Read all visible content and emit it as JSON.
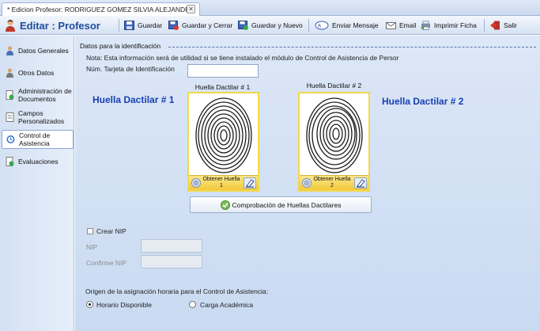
{
  "tab": {
    "title": "* Edicion Profesor: RODRIGUEZ GOMEZ SILVIA ALEJANDRA",
    "close": "✕"
  },
  "toolbar": {
    "title": "Editar : Profesor",
    "save": "Guardar",
    "save_close": "Guardar y Cerrar",
    "save_new": "Guardar y Nuevo",
    "send_message": "Enviar Mensaje",
    "email": "Email",
    "print": "Imprimir Ficha",
    "exit": "Salir"
  },
  "sidebar": {
    "items": [
      {
        "label": "Datos Generales"
      },
      {
        "label": "Otros Datos"
      },
      {
        "label": "Administración de Documentos"
      },
      {
        "label": "Campos Personalizados"
      },
      {
        "label": "Control de Asistencia"
      },
      {
        "label": "Evaluaciones"
      }
    ]
  },
  "form": {
    "group_title": "Datos para la identificación",
    "note": "Nota: Esta información será de utilidad si se tiene instalado el módulo de Control de Asistencia de Persor",
    "card_label": "Núm. Tarjeta de Identificación",
    "card_value": "",
    "fp1_big": "Huella Dactilar # 1",
    "fp2_big": "Huella Dactilar # 2",
    "fp1_caption": "Huella Dactilar # 1",
    "fp2_caption": "Huella Dactilar # 2",
    "fp1_get": "Obtener Huella 1",
    "fp2_get": "Obtener Huella 2",
    "check_button": "Comprobación de Huellas Dactilares",
    "create_nip": "Crear NIP",
    "nip_label": "NIP",
    "confirm_nip_label": "Confirme NIP",
    "schedule_label": "Origen de la asignación horaria para el Control de Asistencia:",
    "option_available": "Horario Disponible",
    "option_academic": "Carga Académica",
    "selected_option": "Horario Disponible"
  },
  "colors": {
    "accent": "#1740b0",
    "highlight": "#f2d84a"
  },
  "icons": [
    "user-icon",
    "save-icon",
    "save-close-icon",
    "save-new-icon",
    "message-icon",
    "email-icon",
    "print-icon",
    "exit-icon",
    "fingerprint-icon",
    "eraser-icon",
    "check-icon"
  ]
}
